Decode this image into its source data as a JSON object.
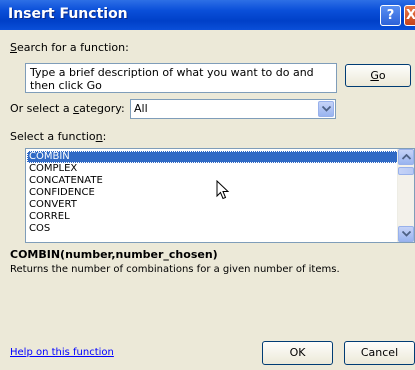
{
  "window": {
    "title": "Insert Function",
    "help_button": "?",
    "close_button": "X"
  },
  "search": {
    "label_key": "S",
    "label_rest": "earch for a function:",
    "value": "Type a brief description of what you want to do and then click Go",
    "go_key": "G",
    "go_rest": "o"
  },
  "category": {
    "label_pre": "Or select a ",
    "label_key": "c",
    "label_post": "ategory:",
    "selected": "All"
  },
  "functions": {
    "label_pre": "Select a functio",
    "label_key": "n",
    "label_post": ":",
    "items": [
      "COMBIN",
      "COMPLEX",
      "CONCATENATE",
      "CONFIDENCE",
      "CONVERT",
      "CORREL",
      "COS"
    ],
    "selected": "COMBIN"
  },
  "details": {
    "syntax": "COMBIN(number,number_chosen)",
    "description": "Returns the number of combinations for a given number of items."
  },
  "footer": {
    "help_link": "Help on this function",
    "ok_label": "OK",
    "cancel_label": "Cancel"
  },
  "icons": {
    "help": "question-mark-icon",
    "close": "close-icon",
    "dropdown": "chevron-down-icon",
    "scroll_up": "chevron-up-icon",
    "scroll_down": "chevron-down-icon",
    "cursor": "mouse-pointer-icon"
  },
  "colors": {
    "titlebar": "#0a4fd9",
    "selection": "#316ac5",
    "dialog_bg": "#ece9d8",
    "link": "#0000ff"
  }
}
